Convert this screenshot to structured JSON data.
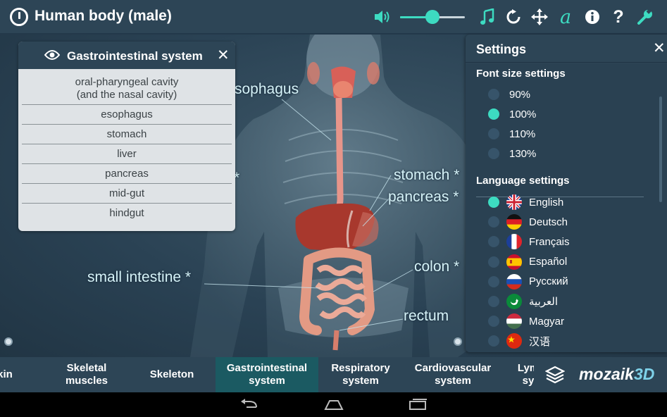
{
  "header": {
    "title": "Human body (male)",
    "volume_percent": 50,
    "accent_color": "#3ddbc1",
    "icons": [
      "power-icon",
      "volume-icon",
      "music-icon",
      "reset-icon",
      "move-icon",
      "font-icon",
      "info-icon",
      "help-icon",
      "settings-wrench-icon"
    ]
  },
  "scene": {
    "labels": {
      "esophagus": "sophagus",
      "stomach": "stomach",
      "pancreas": "pancreas",
      "colon": "colon",
      "rectum": "rectum",
      "small_intestine": "small intestine",
      "asterisk": "*"
    }
  },
  "system_panel": {
    "title": "Gastrointestinal system",
    "close": "✕",
    "items": [
      "oral-pharyngeal cavity\n(and the nasal cavity)",
      "esophagus",
      "stomach",
      "liver",
      "pancreas",
      "mid-gut",
      "hindgut"
    ]
  },
  "settings": {
    "title": "Settings",
    "close": "✕",
    "font_section": "Font size settings",
    "font_sizes": [
      {
        "label": "90%",
        "selected": false
      },
      {
        "label": "100%",
        "selected": true
      },
      {
        "label": "110%",
        "selected": false
      },
      {
        "label": "130%",
        "selected": false
      }
    ],
    "language_section": "Language settings",
    "languages": [
      {
        "label": "English",
        "flag": "uk",
        "selected": true
      },
      {
        "label": "Deutsch",
        "flag": "de",
        "selected": false
      },
      {
        "label": "Français",
        "flag": "fr",
        "selected": false
      },
      {
        "label": "Español",
        "flag": "es",
        "selected": false
      },
      {
        "label": "Русский",
        "flag": "ru",
        "selected": false
      },
      {
        "label": "العربية",
        "flag": "sa",
        "selected": false
      },
      {
        "label": "Magyar",
        "flag": "hu",
        "selected": false
      },
      {
        "label": "汉语",
        "flag": "cn",
        "selected": false
      }
    ]
  },
  "bottom_nav": {
    "tabs": [
      {
        "label": "kin",
        "active": false
      },
      {
        "label": "Skeletal\nmuscles",
        "active": false
      },
      {
        "label": "Skeleton",
        "active": false
      },
      {
        "label": "Gastrointestinal\nsystem",
        "active": true
      },
      {
        "label": "Respiratory\nsystem",
        "active": false
      },
      {
        "label": "Cardiovascular\nsystem",
        "active": false
      },
      {
        "label": "Lym\nsy",
        "active": false
      }
    ],
    "brand_main": "mozaik",
    "brand_suffix": "3D"
  }
}
